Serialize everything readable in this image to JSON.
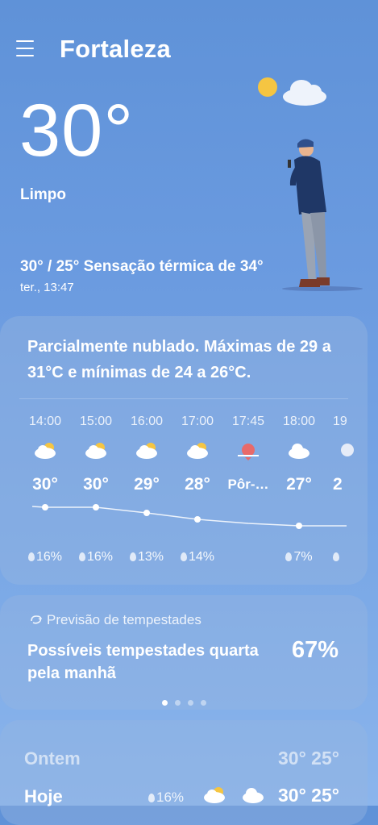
{
  "header": {
    "city": "Fortaleza"
  },
  "current": {
    "temp": "30°",
    "condition": "Limpo",
    "range": "30° / 25° Sensação térmica de 34°",
    "datetime": "ter., 13:47"
  },
  "forecast_card": {
    "summary": "Parcialmente nublado. Máximas de 29 a 31°C e mínimas de 24 a 26°C.",
    "hours": [
      {
        "time": "14:00",
        "temp": "30°",
        "rain": "16%",
        "icon": "partly-cloudy-icon"
      },
      {
        "time": "15:00",
        "temp": "30°",
        "rain": "16%",
        "icon": "partly-cloudy-icon"
      },
      {
        "time": "16:00",
        "temp": "29°",
        "rain": "13%",
        "icon": "partly-cloudy-icon"
      },
      {
        "time": "17:00",
        "temp": "28°",
        "rain": "14%",
        "icon": "partly-cloudy-icon"
      },
      {
        "time": "17:45",
        "temp": "Pôr-…",
        "rain": "",
        "icon": "sunset-icon"
      },
      {
        "time": "18:00",
        "temp": "27°",
        "rain": "7%",
        "icon": "cloudy-night-icon"
      },
      {
        "time": "19",
        "temp": "2",
        "rain": "",
        "icon": "moon-icon"
      }
    ]
  },
  "storm_card": {
    "header": "Previsão de tempestades",
    "text": "Possíveis tempestades quarta pela manhã",
    "percent": "67%",
    "page_count": 4,
    "active_page": 1
  },
  "daily": {
    "yesterday": {
      "label": "Ontem",
      "temps": "30° 25°"
    },
    "today": {
      "label": "Hoje",
      "rain": "16%",
      "temps": "30° 25°"
    }
  },
  "colors": {
    "background": "#6b9be0",
    "sun": "#f5c542",
    "sunset": "#e86a6a"
  }
}
